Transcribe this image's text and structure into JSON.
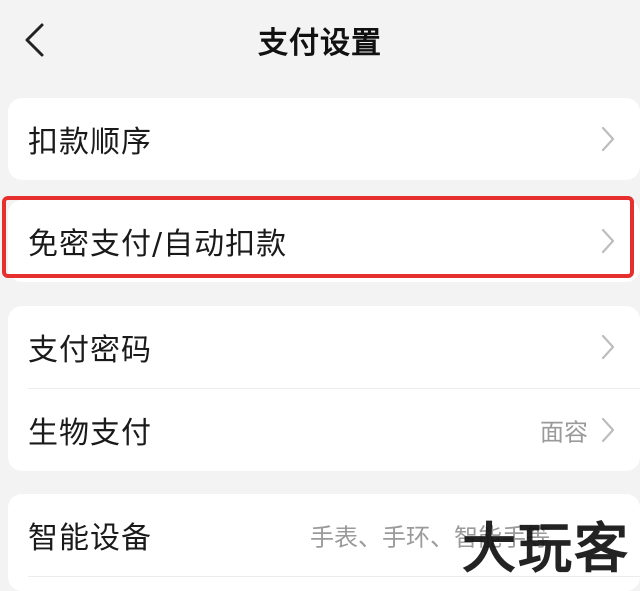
{
  "header": {
    "title": "支付设置"
  },
  "card1": {
    "items": [
      {
        "label": "扣款顺序"
      }
    ]
  },
  "card2": {
    "items": [
      {
        "label": "免密支付/自动扣款"
      }
    ]
  },
  "card3": {
    "items": [
      {
        "label": "支付密码"
      },
      {
        "label": "生物支付",
        "value": "面容"
      }
    ]
  },
  "card4": {
    "items": [
      {
        "label": "智能设备",
        "value": "手表、手环、智能手等"
      }
    ]
  },
  "watermark": {
    "text": "大玩客"
  },
  "colors": {
    "highlight": "#e5302d",
    "background": "#f3f3f3",
    "card": "#ffffff"
  }
}
